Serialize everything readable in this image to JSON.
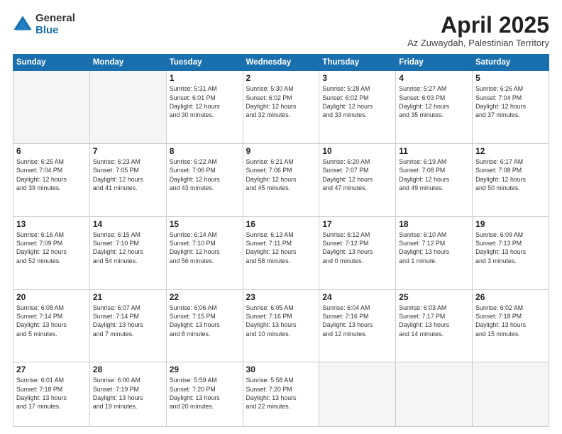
{
  "logo": {
    "general": "General",
    "blue": "Blue"
  },
  "header": {
    "month": "April 2025",
    "location": "Az Zuwaydah, Palestinian Territory"
  },
  "days_of_week": [
    "Sunday",
    "Monday",
    "Tuesday",
    "Wednesday",
    "Thursday",
    "Friday",
    "Saturday"
  ],
  "weeks": [
    [
      {
        "day": null,
        "info": null
      },
      {
        "day": null,
        "info": null
      },
      {
        "day": "1",
        "info": "Sunrise: 5:31 AM\nSunset: 6:01 PM\nDaylight: 12 hours\nand 30 minutes."
      },
      {
        "day": "2",
        "info": "Sunrise: 5:30 AM\nSunset: 6:02 PM\nDaylight: 12 hours\nand 32 minutes."
      },
      {
        "day": "3",
        "info": "Sunrise: 5:28 AM\nSunset: 6:02 PM\nDaylight: 12 hours\nand 33 minutes."
      },
      {
        "day": "4",
        "info": "Sunrise: 5:27 AM\nSunset: 6:03 PM\nDaylight: 12 hours\nand 35 minutes."
      },
      {
        "day": "5",
        "info": "Sunrise: 6:26 AM\nSunset: 7:04 PM\nDaylight: 12 hours\nand 37 minutes."
      }
    ],
    [
      {
        "day": "6",
        "info": "Sunrise: 6:25 AM\nSunset: 7:04 PM\nDaylight: 12 hours\nand 39 minutes."
      },
      {
        "day": "7",
        "info": "Sunrise: 6:23 AM\nSunset: 7:05 PM\nDaylight: 12 hours\nand 41 minutes."
      },
      {
        "day": "8",
        "info": "Sunrise: 6:22 AM\nSunset: 7:06 PM\nDaylight: 12 hours\nand 43 minutes."
      },
      {
        "day": "9",
        "info": "Sunrise: 6:21 AM\nSunset: 7:06 PM\nDaylight: 12 hours\nand 45 minutes."
      },
      {
        "day": "10",
        "info": "Sunrise: 6:20 AM\nSunset: 7:07 PM\nDaylight: 12 hours\nand 47 minutes."
      },
      {
        "day": "11",
        "info": "Sunrise: 6:19 AM\nSunset: 7:08 PM\nDaylight: 12 hours\nand 49 minutes."
      },
      {
        "day": "12",
        "info": "Sunrise: 6:17 AM\nSunset: 7:08 PM\nDaylight: 12 hours\nand 50 minutes."
      }
    ],
    [
      {
        "day": "13",
        "info": "Sunrise: 6:16 AM\nSunset: 7:09 PM\nDaylight: 12 hours\nand 52 minutes."
      },
      {
        "day": "14",
        "info": "Sunrise: 6:15 AM\nSunset: 7:10 PM\nDaylight: 12 hours\nand 54 minutes."
      },
      {
        "day": "15",
        "info": "Sunrise: 6:14 AM\nSunset: 7:10 PM\nDaylight: 12 hours\nand 56 minutes."
      },
      {
        "day": "16",
        "info": "Sunrise: 6:13 AM\nSunset: 7:11 PM\nDaylight: 12 hours\nand 58 minutes."
      },
      {
        "day": "17",
        "info": "Sunrise: 6:12 AM\nSunset: 7:12 PM\nDaylight: 13 hours\nand 0 minutes."
      },
      {
        "day": "18",
        "info": "Sunrise: 6:10 AM\nSunset: 7:12 PM\nDaylight: 13 hours\nand 1 minute."
      },
      {
        "day": "19",
        "info": "Sunrise: 6:09 AM\nSunset: 7:13 PM\nDaylight: 13 hours\nand 3 minutes."
      }
    ],
    [
      {
        "day": "20",
        "info": "Sunrise: 6:08 AM\nSunset: 7:14 PM\nDaylight: 13 hours\nand 5 minutes."
      },
      {
        "day": "21",
        "info": "Sunrise: 6:07 AM\nSunset: 7:14 PM\nDaylight: 13 hours\nand 7 minutes."
      },
      {
        "day": "22",
        "info": "Sunrise: 6:06 AM\nSunset: 7:15 PM\nDaylight: 13 hours\nand 8 minutes."
      },
      {
        "day": "23",
        "info": "Sunrise: 6:05 AM\nSunset: 7:16 PM\nDaylight: 13 hours\nand 10 minutes."
      },
      {
        "day": "24",
        "info": "Sunrise: 6:04 AM\nSunset: 7:16 PM\nDaylight: 13 hours\nand 12 minutes."
      },
      {
        "day": "25",
        "info": "Sunrise: 6:03 AM\nSunset: 7:17 PM\nDaylight: 13 hours\nand 14 minutes."
      },
      {
        "day": "26",
        "info": "Sunrise: 6:02 AM\nSunset: 7:18 PM\nDaylight: 13 hours\nand 15 minutes."
      }
    ],
    [
      {
        "day": "27",
        "info": "Sunrise: 6:01 AM\nSunset: 7:18 PM\nDaylight: 13 hours\nand 17 minutes."
      },
      {
        "day": "28",
        "info": "Sunrise: 6:00 AM\nSunset: 7:19 PM\nDaylight: 13 hours\nand 19 minutes."
      },
      {
        "day": "29",
        "info": "Sunrise: 5:59 AM\nSunset: 7:20 PM\nDaylight: 13 hours\nand 20 minutes."
      },
      {
        "day": "30",
        "info": "Sunrise: 5:58 AM\nSunset: 7:20 PM\nDaylight: 13 hours\nand 22 minutes."
      },
      {
        "day": null,
        "info": null
      },
      {
        "day": null,
        "info": null
      },
      {
        "day": null,
        "info": null
      }
    ]
  ]
}
